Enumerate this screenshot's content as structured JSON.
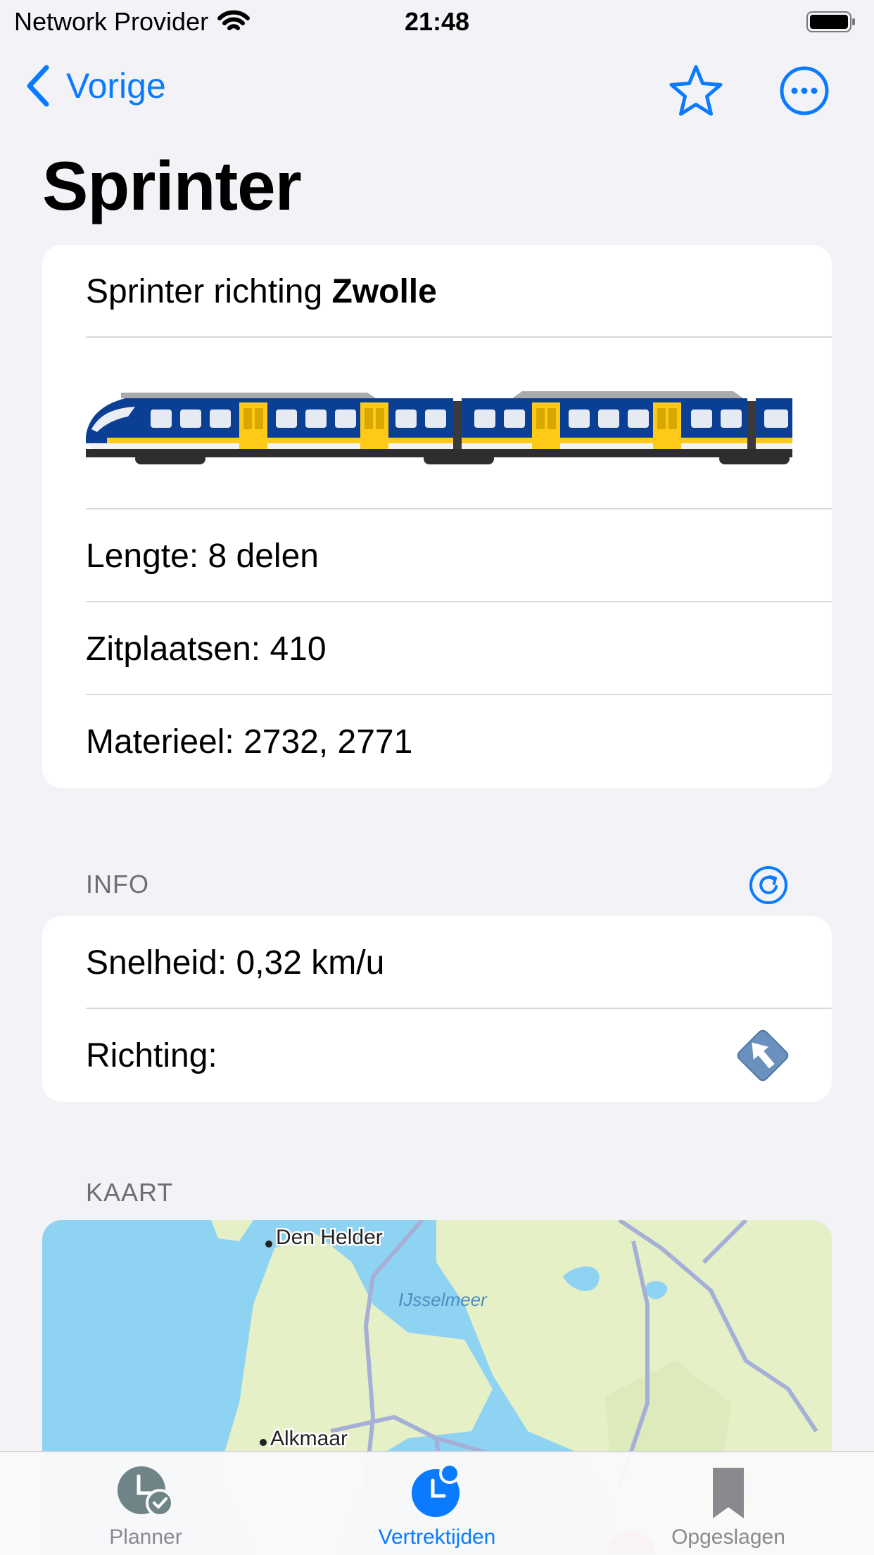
{
  "status_bar": {
    "carrier": "Network Provider",
    "time": "21:48"
  },
  "nav": {
    "back_label": "Vorige"
  },
  "page_title": "Sprinter",
  "train_card": {
    "heading_prefix": "Sprinter richting ",
    "destination": "Zwolle",
    "length": "Lengte: 8 delen",
    "seats": "Zitplaatsen: 410",
    "material": "Materieel: 2732, 2771"
  },
  "info_section": {
    "header": "INFO",
    "speed": "Snelheid: 0,32 km/u",
    "direction_label": "Richting:"
  },
  "map_section": {
    "header": "KAART",
    "labels": {
      "den_helder": "Den Helder",
      "ijsselmeer": "IJsselmeer",
      "alkmaar": "Alkmaar"
    }
  },
  "tabs": [
    {
      "label": "Planner",
      "active": false
    },
    {
      "label": "Vertrektijden",
      "active": true
    },
    {
      "label": "Opgeslagen",
      "active": false
    }
  ],
  "colors": {
    "accent": "#0A7AFF",
    "inactive": "#8A8A8E",
    "ns_blue": "#0B3F94",
    "ns_yellow": "#FFC917",
    "map_water": "#8FD3F2",
    "map_land": "#E6F0C6"
  }
}
